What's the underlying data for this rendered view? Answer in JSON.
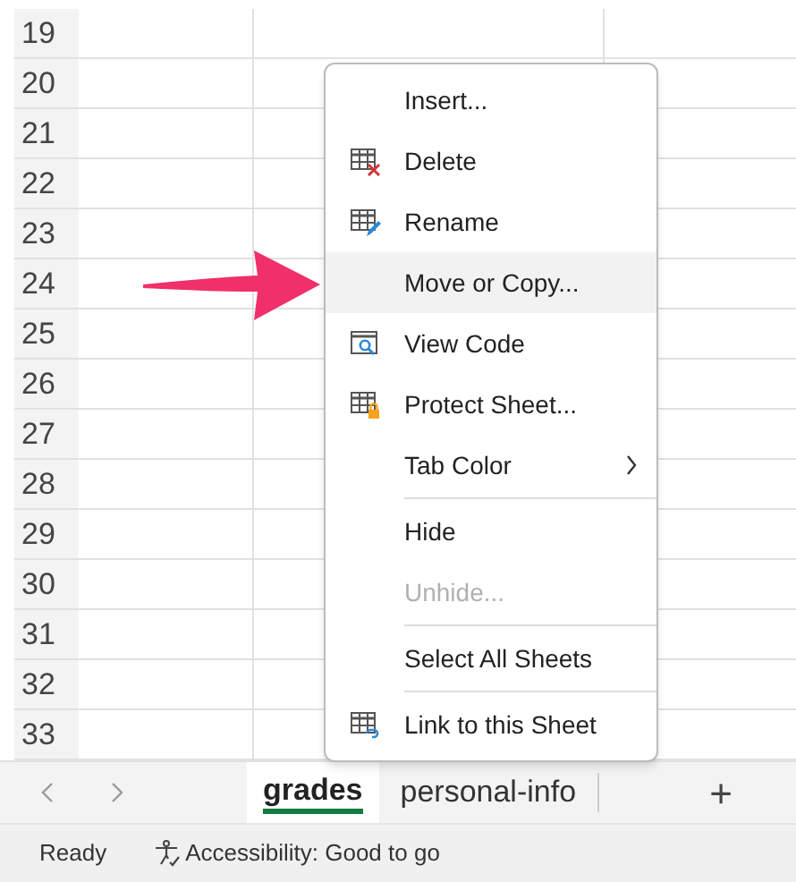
{
  "rows": [
    "19",
    "20",
    "21",
    "22",
    "23",
    "24",
    "25",
    "26",
    "27",
    "28",
    "29",
    "30",
    "31",
    "32",
    "33"
  ],
  "context_menu": [
    {
      "kind": "item",
      "label": "Insert...",
      "disabled": false,
      "selected": false
    },
    {
      "kind": "item",
      "label": "Delete",
      "disabled": false,
      "selected": false
    },
    {
      "kind": "item",
      "label": "Rename",
      "disabled": false,
      "selected": false
    },
    {
      "kind": "item",
      "label": "Move or Copy...",
      "disabled": false,
      "selected": true
    },
    {
      "kind": "item",
      "label": "View Code",
      "disabled": false,
      "selected": false
    },
    {
      "kind": "item",
      "label": "Protect Sheet...",
      "disabled": false,
      "selected": false
    },
    {
      "kind": "submenu",
      "label": "Tab Color",
      "disabled": false,
      "selected": false
    },
    {
      "kind": "separator"
    },
    {
      "kind": "item",
      "label": "Hide",
      "disabled": false,
      "selected": false
    },
    {
      "kind": "item",
      "label": "Unhide...",
      "disabled": true,
      "selected": false
    },
    {
      "kind": "separator"
    },
    {
      "kind": "item",
      "label": "Select All Sheets",
      "disabled": false,
      "selected": false
    },
    {
      "kind": "separator"
    },
    {
      "kind": "item",
      "label": "Link to this Sheet",
      "disabled": false,
      "selected": false
    }
  ],
  "sheet_tabs": [
    {
      "label": "grades",
      "selected": true
    },
    {
      "label": "personal-info",
      "selected": false
    }
  ],
  "add_sheet": "+",
  "status_bar": {
    "status": "Ready",
    "accessibility": "Accessibility: Good to go"
  }
}
